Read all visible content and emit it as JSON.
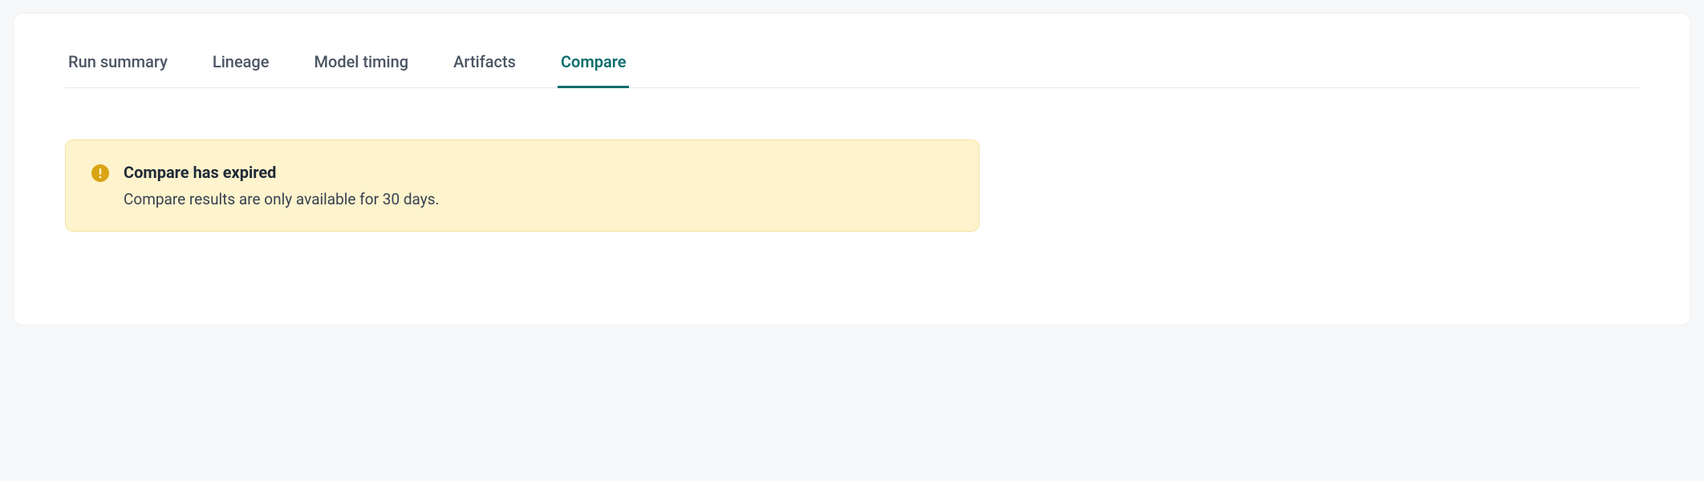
{
  "tabs": [
    {
      "label": "Run summary",
      "active": false
    },
    {
      "label": "Lineage",
      "active": false
    },
    {
      "label": "Model timing",
      "active": false
    },
    {
      "label": "Artifacts",
      "active": false
    },
    {
      "label": "Compare",
      "active": true
    }
  ],
  "alert": {
    "title": "Compare has expired",
    "message": "Compare results are only available for 30 days."
  }
}
